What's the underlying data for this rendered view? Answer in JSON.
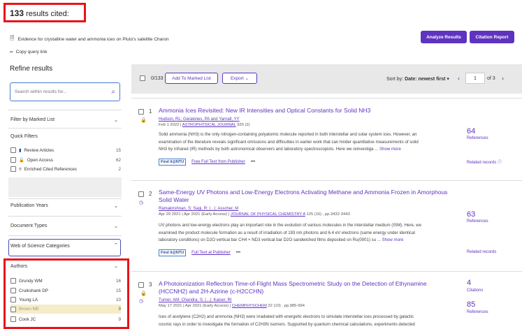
{
  "header": {
    "count": "133",
    "count_suffix": "results cited:",
    "document_title": "Evidence for crystalline water and ammonia ices on Pluto's satellite Charon",
    "copy_link": "Copy query link",
    "analyze_button": "Analyze Results",
    "citation_button": "Citation Report"
  },
  "sidebar": {
    "refine_title": "Refine results",
    "search_placeholder": "Search within results for...",
    "filter_marked": "Filter by Marked List",
    "quick_filters_title": "Quick Filters",
    "quick_filters": [
      {
        "label": "Review Articles",
        "count": "15"
      },
      {
        "label": "Open Access",
        "count": "62"
      },
      {
        "label": "Enriched Cited References",
        "count": "2"
      }
    ],
    "publication_years": "Publication Years",
    "document_types": "Document Types",
    "wos_categories": "Web of Science Categories",
    "authors_title": "Authors",
    "authors": [
      {
        "label": "Grundy WM",
        "count": "16"
      },
      {
        "label": "Cruikshank DP",
        "count": "15"
      },
      {
        "label": "Young LA",
        "count": "10"
      },
      {
        "label": "Brown ME",
        "count": "9"
      },
      {
        "label": "Cook JC",
        "count": "9"
      }
    ]
  },
  "toolbar": {
    "selected": "0/133",
    "add_marked": "Add To Marked List",
    "export": "Export",
    "sort_label": "Sort by:",
    "sort_value": "Date: newest first",
    "page": "1",
    "of_pages": "of 3"
  },
  "results": [
    {
      "num": "1",
      "title": "Ammonia Ices Revisited: New IR Intensities and Optical Constants for Solid NH3",
      "authors_prefix": "Hudson, RL",
      "authors_rest": "Gerakines, PA",
      "authors_and": "and",
      "authors_last": "Yarnall, YY",
      "meta": "Feb 1 2022",
      "journal": "ASTROPHYSICAL JOURNAL",
      "meta_suffix": "925 (2)",
      "abstract_1": "Solid ammonia (NH3) is the only nitrogen-containing polyatomic molecule reported in both interstellar and solar system ices. However, an",
      "abstract_2": "examination of the literature reveals significant omissions and difficulties in earlier work that can hinder quantitative measurements of solid",
      "abstract_3": "NH3 by infrared (IR) methods by both astronomical observers and laboratory spectroscopists. Here we reinvestiga ...",
      "show_more": "Show more",
      "findit": "Find it@NTU",
      "fulltext": "Free Full Text from Publisher",
      "stat_num": "64",
      "stat_label": "References",
      "related": "Related records"
    },
    {
      "num": "2",
      "title_1": "Same-Energy UV Photons and Low-Energy Electrons Activating Methane and Ammonia Frozen in Amorphous",
      "title_2": "Solid Water",
      "authors_prefix": "Ramakrishnan, S",
      "authors_rest": "Sagi, R",
      "authors_mid": "(...)",
      "authors_last": "Asscher, M",
      "meta": "Apr 29 2021 | Apr 2021 (Early Access) |",
      "journal": "JOURNAL OF PHYSICAL CHEMISTRY A",
      "meta_suffix": "125 (16) , pp.3432-3443",
      "abstract_1": "UV photons and low-energy electrons play an important role in the evolution of various molecules in the interstellar medium (ISM). Here, we",
      "abstract_2": "examined the product molecule formation as a result of irradiation of 193 nm photons and 6.4 eV electrons (same energy under identical",
      "abstract_3": "laboratory conditions) on D2O vertical bar CH4 + ND3 vertical bar D2O sandwiched films deposited on Ru(0001) su ...",
      "show_more": "Show more",
      "findit": "Find it@NTU",
      "fulltext": "Full Text at Publisher",
      "stat_num": "63",
      "stat_label": "References",
      "related": "Related records"
    },
    {
      "num": "3",
      "title_1": "A Photoionization Reflectron Time-of-Flight Mass Spectrometric Study on the Detection of Ethynamine",
      "title_2": "(HCCNH2) and 2H-Azirine (c-H2CCHN)",
      "authors_prefix": "Turner, AM",
      "authors_rest": "Chandra, S",
      "authors_mid": "(...)",
      "authors_last": "Kaiser, RI",
      "meta": "May 17 2021 | Apr 2021 (Early Access) |",
      "journal": "CHEMPHYSCHEM",
      "meta_suffix": "22 (10) , pp.985-994",
      "abstract_1": "Ices of acetylene (C2H2) and ammonia (NH3) were irradiated with energetic electrons to simulate interstellar ices processed by galactic",
      "abstract_2": "cosmic rays in order to investigate the formation of C2H3N isomers. Supported by quantum chemical calculations, experiments detected",
      "stat_num": "4",
      "stat_label": "Citations",
      "stat_num2": "85",
      "stat_label2": "References"
    }
  ]
}
